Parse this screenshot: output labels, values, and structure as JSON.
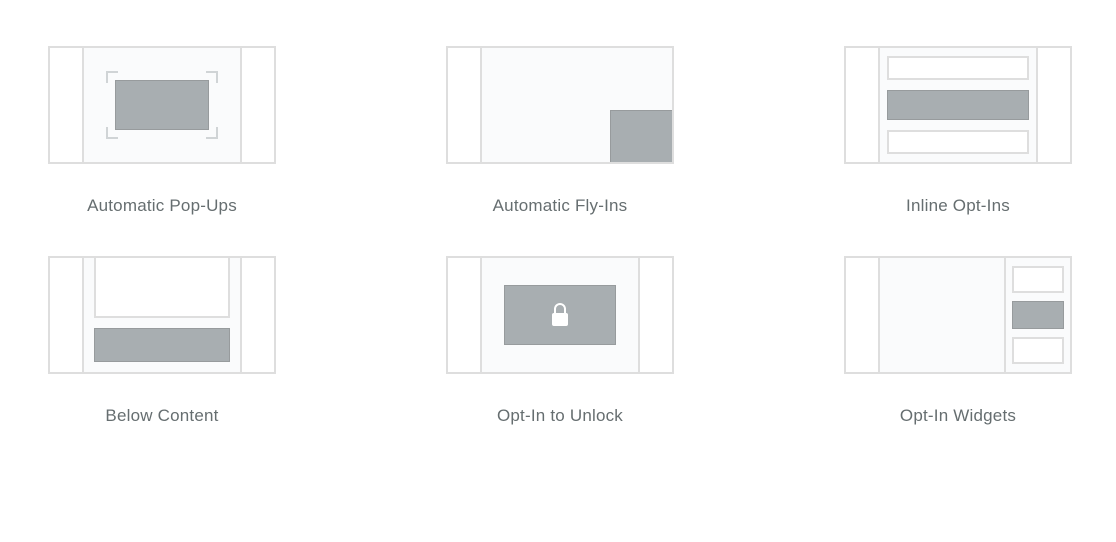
{
  "options": [
    {
      "key": "popup",
      "label": "Automatic Pop-Ups"
    },
    {
      "key": "flyin",
      "label": "Automatic Fly-Ins"
    },
    {
      "key": "inline",
      "label": "Inline Opt-Ins"
    },
    {
      "key": "below",
      "label": "Below Content"
    },
    {
      "key": "unlock",
      "label": "Opt-In to Unlock"
    },
    {
      "key": "widget",
      "label": "Opt-In Widgets"
    }
  ]
}
